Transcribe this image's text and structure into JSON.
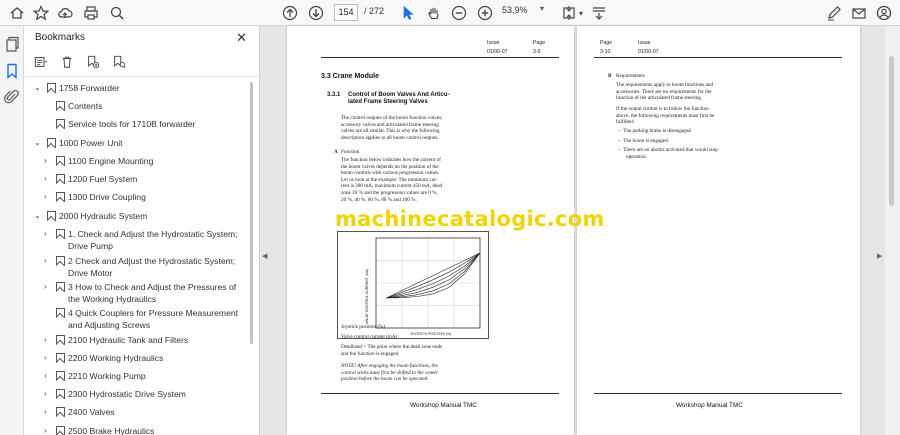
{
  "toolbar": {
    "page_current": "154",
    "page_total": "/ 272",
    "zoom": "53,9%"
  },
  "bookmarks": {
    "title": "Bookmarks",
    "items": [
      {
        "label": "1758 Forwarder",
        "expanded": true
      },
      {
        "label": "Contents"
      },
      {
        "label": "Service tools for 1710B forwarder"
      },
      {
        "label": "1000 Power Unit",
        "expanded": true
      },
      {
        "label": "1100 Engine Mounting"
      },
      {
        "label": "1200 Fuel System"
      },
      {
        "label": "1300 Drive Coupling"
      },
      {
        "label": "2000 Hydraulic System",
        "expanded": true
      },
      {
        "label": "1. Check and Adjust the Hydrostatic System;",
        "label2": "Drive Pump"
      },
      {
        "label": "2 Check and Adjust the Hydrostatic System;",
        "label2": "Drive Motor"
      },
      {
        "label": "3 How to Check and Adjust the Pressures of",
        "label2": "the Working Hydraulics"
      },
      {
        "label": "4 Quick Couplers for Pressure Measurement",
        "label2": "and Adjusting Screws"
      },
      {
        "label": "2100 Hydraulic Tank and Filters"
      },
      {
        "label": "2200 Working Hydraulics"
      },
      {
        "label": "2210 Working Pump"
      },
      {
        "label": "2300 Hydrostatic Drive System"
      },
      {
        "label": "2400 Valves"
      },
      {
        "label": "2500 Brake Hydraulics"
      }
    ]
  },
  "page_left": {
    "issue_label": "Issue",
    "page_label": "Page",
    "issue_value": "01/00-07",
    "page_value": "3-9",
    "section": "3.3  Crane Module",
    "subsection_num": "3.3.1",
    "subsection_line1": "Control of Boom Valves And Articu-",
    "subsection_line2": "lated Frame Steering Valves",
    "para1": [
      "The control outputs of the boom function valves,",
      "accessory valves and articulated frame steering",
      "valves are all similar.  This is why the following",
      "description applies to all boom control outputs."
    ],
    "a_label": "A",
    "a_title": "Function",
    "para2": [
      "The function below indicates how the current of",
      "the boom valves depends on the position of the",
      "boom controls with various progression values.",
      "Let us look at the example: The minimum cur-",
      "rent is 300 mA, maximum current 450 mA, dead",
      "zone 10 % and the progression values are 0 %,",
      "20 %, 40 %, 60 %, 80 % and 100 %."
    ],
    "chart_ylabel": "VALVE CONTROL CURRENT (mA)",
    "chart_xlabel": "JOYSTICK POSITION (%)",
    "cap1": "Joystick position (%)",
    "cap2": "Valve control current (mA)",
    "cap3a": "Deadband = The point where the dead zone ends",
    "cap3b": "and the function is engaged.",
    "note": [
      "NOTE! After engaging the boom functions, the",
      "control sticks must first be shifted to the center",
      "position before the boom can be operated."
    ],
    "footer": "Workshop Manual TMC"
  },
  "page_right": {
    "page_label": "Page",
    "issue_label": "Issue",
    "page_value": "3-10",
    "issue_value": "01/00-07",
    "b_label": "B",
    "b_title": "Requirements",
    "para1": [
      "The requirements apply to boom functions and",
      "accessories.  There are no requirements for the",
      "function of the articulated frame steering."
    ],
    "para2": [
      "If the output current is to follow the function",
      "above, the following requirements must first be",
      "fulfilled:"
    ],
    "bullets": [
      "The parking brake is disengaged.",
      "The boom is engaged.",
      "There are no alarms activated that would stop",
      "operation."
    ],
    "footer": "Workshop Manual TMC"
  },
  "watermark": "machinecatalogic.com",
  "chart_data": {
    "type": "line",
    "xlabel": "JOYSTICK POSITION (%)",
    "ylabel": "VALVE CONTROL CURRENT (mA)",
    "x": [
      10,
      25,
      40,
      55,
      70,
      85,
      100
    ],
    "series": [
      {
        "values": [
          300,
          325,
          350,
          375,
          400,
          425,
          450
        ]
      },
      {
        "values": [
          300,
          319,
          339,
          361,
          386,
          416,
          450
        ]
      },
      {
        "values": [
          300,
          313,
          329,
          348,
          373,
          406,
          450
        ]
      },
      {
        "values": [
          300,
          308,
          319,
          336,
          360,
          397,
          450
        ]
      },
      {
        "values": [
          300,
          304,
          311,
          324,
          347,
          388,
          450
        ]
      },
      {
        "values": [
          300,
          301,
          305,
          314,
          335,
          380,
          450
        ]
      }
    ],
    "xlim": [
      0,
      100
    ],
    "ylim": [
      200,
      500
    ]
  }
}
